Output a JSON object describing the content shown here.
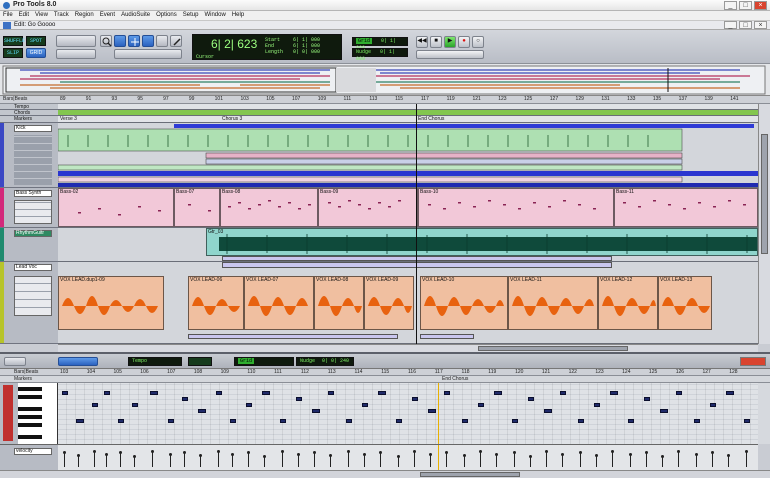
{
  "window": {
    "title": "Pro Tools 8.0",
    "edit_title": "Edit: Go Goooo",
    "minimize": "_",
    "maximize": "□",
    "close": "×"
  },
  "menu": [
    "File",
    "Edit",
    "View",
    "Track",
    "Region",
    "Event",
    "AudioSuite",
    "Options",
    "Setup",
    "Window",
    "Help"
  ],
  "toolbar": {
    "modes": [
      "SHUFFLE",
      "SPOT",
      "SLIP",
      "GRID"
    ],
    "main_counter": "6| 2| 623",
    "sel_labels": [
      "Start",
      "End",
      "Length"
    ],
    "sel_values": [
      "6| 1| 000",
      "6| 1| 000",
      "0| 0| 000"
    ],
    "cursor_label": "Cursor",
    "grid_label": "Grid",
    "grid_value": "0| 1| 000",
    "nudge_label": "Nudge",
    "nudge_value": "0| 1| 000"
  },
  "ruler": {
    "label": "Bars|Beats",
    "bars": [
      "89",
      "91",
      "93",
      "95",
      "97",
      "99",
      "101",
      "103",
      "105",
      "107",
      "109",
      "111",
      "113",
      "115",
      "117",
      "119",
      "121",
      "123",
      "125",
      "127",
      "129",
      "131",
      "133",
      "135",
      "137",
      "139",
      "141"
    ]
  },
  "ruler_rows": [
    "Tempo",
    "Chords",
    "Markers"
  ],
  "markers": [
    "Verse 3",
    "Chorus 3",
    "End Chorus"
  ],
  "tracks": [
    {
      "name": "Kick"
    },
    {
      "name": "Bass Synth"
    },
    {
      "name": "RhythmGuitr"
    },
    {
      "name": "Lead Voc"
    }
  ],
  "clips": {
    "bass": [
      "Bass-02",
      "Bass-07",
      "Bass-08",
      "Bass-09",
      "Bass-10",
      "Bass-11"
    ],
    "rhythm": [
      "Gtr_03"
    ],
    "vox": [
      "VOX LEAD.dup1-09",
      "VOX LEAD-06",
      "VOX LEAD-07",
      "VOX LEAD-08",
      "VOX LEAD-09",
      "VOX LEAD-10",
      "VOX LEAD-11",
      "VOX LEAD-12",
      "VOX LEAD-13"
    ]
  },
  "midi_editor": {
    "bars": [
      "103",
      "104",
      "105",
      "106",
      "107",
      "108",
      "109",
      "110",
      "111",
      "112",
      "113",
      "114",
      "115",
      "116",
      "117",
      "118",
      "119",
      "120",
      "121",
      "122",
      "123",
      "124",
      "125",
      "126",
      "127",
      "128"
    ],
    "markers_label": "Markers",
    "marker": "End Chorus",
    "velocity_label": "velocity",
    "tempo_value": "Tempo",
    "nudge_label": "Nudge",
    "nudge_value": "0| 0| 240"
  },
  "colors": {
    "bass_clip": "#f2c8d8",
    "rhythm_clip": "#8fd5cc",
    "vox_clip": "#f0bfa0",
    "vox_wave": "#e8620f",
    "rhythm_wave": "#0f4a3b",
    "lcd_green": "#7ef065",
    "accent_blue": "#2b62c0"
  }
}
